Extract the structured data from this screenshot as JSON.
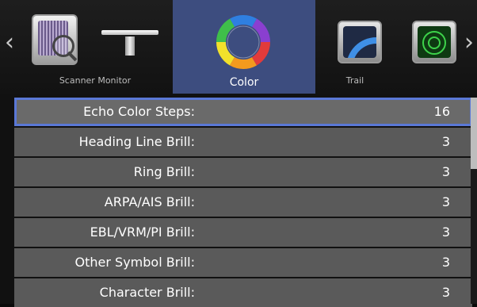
{
  "tabs": [
    {
      "label": "Scanner Monitor",
      "icons": [
        "scanner-icon",
        "monitor-icon"
      ],
      "selected": false
    },
    {
      "label": "Color",
      "icon": "color-wheel-icon",
      "selected": true
    },
    {
      "label": "Trail",
      "icon": "trail-icon",
      "selected": false
    },
    {
      "label": "",
      "icon": "radar-icon",
      "selected": false
    }
  ],
  "nav": {
    "left": "‹",
    "right": "›"
  },
  "settings": [
    {
      "label": "Echo Color Steps:",
      "value": "16",
      "selected": true
    },
    {
      "label": "Heading Line Brill:",
      "value": "3",
      "selected": false
    },
    {
      "label": "Ring Brill:",
      "value": "3",
      "selected": false
    },
    {
      "label": "ARPA/AIS Brill:",
      "value": "3",
      "selected": false
    },
    {
      "label": "EBL/VRM/PI Brill:",
      "value": "3",
      "selected": false
    },
    {
      "label": "Other Symbol Brill:",
      "value": "3",
      "selected": false
    },
    {
      "label": "Character Brill:",
      "value": "3",
      "selected": false
    }
  ],
  "colors": {
    "selected_tab": "#3d4d7f",
    "selection_outline": "#5a78d6",
    "row_bg": "#5a5a5a"
  }
}
